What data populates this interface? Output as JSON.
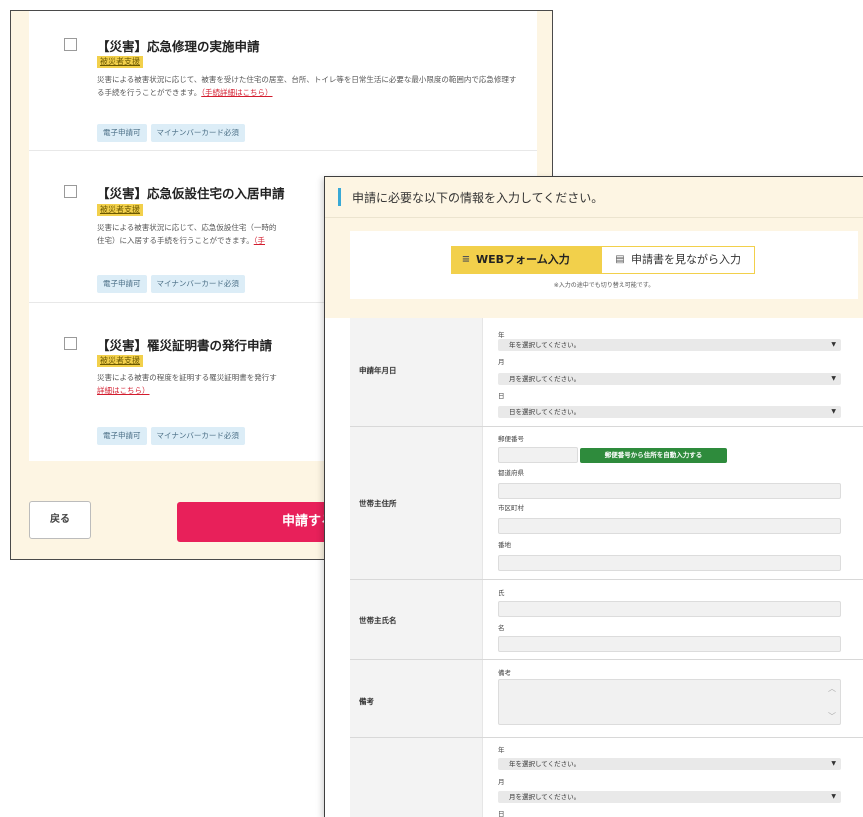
{
  "back_window": {
    "services": [
      {
        "title": "【災害】応急修理の実施申請",
        "badge": "被災者支援",
        "description": "災害による被害状況に応じて、被害を受けた住宅の居室、台所、トイレ等を日常生活に必要な最小限度の範囲内で応急修理する手続を行うことができます。",
        "link": "（手続詳細はこちら）",
        "tags": [
          "電子申請可",
          "マイナンバーカード必須"
        ]
      },
      {
        "title": "【災害】応急仮設住宅の入居申請",
        "badge": "被災者支援",
        "description": "災害による被害状況に応じて、応急仮設住宅（一時的",
        "description2": "住宅）に入居する手続を行うことができます。",
        "link": "（手",
        "tags": [
          "電子申請可",
          "マイナンバーカード必須"
        ]
      },
      {
        "title": "【災害】罹災証明書の発行申請",
        "badge": "被災者支援",
        "description": "災害による被害の程度を証明する罹災証明書を発行す",
        "link": "詳細はこちら）",
        "tags": [
          "電子申請可",
          "マイナンバーカード必須"
        ]
      }
    ],
    "back_label": "戻る",
    "apply_label": "申請する"
  },
  "front_window": {
    "header": "申請に必要な以下の情報を入力してください。",
    "tabs": {
      "web_icon": "≡",
      "web_label": "WEBフォーム入力",
      "pdf_icon": "▤",
      "pdf_label": "申請書を見ながら入力"
    },
    "mode_note": "※入力の途中でも切り替え可能です。",
    "sections": {
      "date": {
        "label": "申請年月日",
        "year_label": "年",
        "year_placeholder": "年を選択してください。",
        "month_label": "月",
        "month_placeholder": "月を選択してください。",
        "day_label": "日",
        "day_placeholder": "日を選択してください。"
      },
      "address": {
        "label": "世帯主住所",
        "zip_label": "郵便番号",
        "zip_button": "郵便番号から住所を自動入力する",
        "pref_label": "都道府県",
        "city_label": "市区町村",
        "street_label": "番地"
      },
      "name": {
        "label": "世帯主氏名",
        "last_label": "氏",
        "first_label": "名"
      },
      "note": {
        "label": "備考",
        "field_label": "備考"
      },
      "date2": {
        "year_label": "年",
        "year_placeholder": "年を選択してください。",
        "month_label": "月",
        "month_placeholder": "月を選択してください。",
        "day_label": "日"
      }
    },
    "select_arrow": "▼"
  },
  "colors": {
    "accent_yellow": "#f2d04b",
    "apply_pink": "#e8205a",
    "zip_green": "#2e8b3c",
    "header_blue": "#39a9d6",
    "cream": "#fdf5e3"
  }
}
